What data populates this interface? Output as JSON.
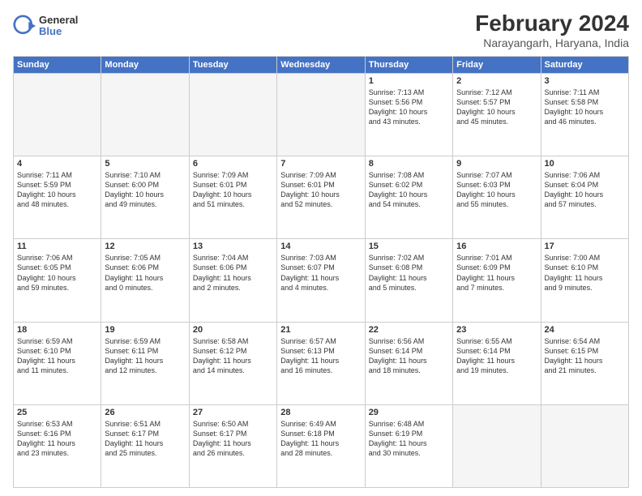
{
  "logo": {
    "general": "General",
    "blue": "Blue"
  },
  "header": {
    "title": "February 2024",
    "subtitle": "Narayangarh, Haryana, India"
  },
  "days": [
    "Sunday",
    "Monday",
    "Tuesday",
    "Wednesday",
    "Thursday",
    "Friday",
    "Saturday"
  ],
  "weeks": [
    [
      {
        "day": "",
        "content": ""
      },
      {
        "day": "",
        "content": ""
      },
      {
        "day": "",
        "content": ""
      },
      {
        "day": "",
        "content": ""
      },
      {
        "day": "1",
        "content": "Sunrise: 7:13 AM\nSunset: 5:56 PM\nDaylight: 10 hours\nand 43 minutes."
      },
      {
        "day": "2",
        "content": "Sunrise: 7:12 AM\nSunset: 5:57 PM\nDaylight: 10 hours\nand 45 minutes."
      },
      {
        "day": "3",
        "content": "Sunrise: 7:11 AM\nSunset: 5:58 PM\nDaylight: 10 hours\nand 46 minutes."
      }
    ],
    [
      {
        "day": "4",
        "content": "Sunrise: 7:11 AM\nSunset: 5:59 PM\nDaylight: 10 hours\nand 48 minutes."
      },
      {
        "day": "5",
        "content": "Sunrise: 7:10 AM\nSunset: 6:00 PM\nDaylight: 10 hours\nand 49 minutes."
      },
      {
        "day": "6",
        "content": "Sunrise: 7:09 AM\nSunset: 6:01 PM\nDaylight: 10 hours\nand 51 minutes."
      },
      {
        "day": "7",
        "content": "Sunrise: 7:09 AM\nSunset: 6:01 PM\nDaylight: 10 hours\nand 52 minutes."
      },
      {
        "day": "8",
        "content": "Sunrise: 7:08 AM\nSunset: 6:02 PM\nDaylight: 10 hours\nand 54 minutes."
      },
      {
        "day": "9",
        "content": "Sunrise: 7:07 AM\nSunset: 6:03 PM\nDaylight: 10 hours\nand 55 minutes."
      },
      {
        "day": "10",
        "content": "Sunrise: 7:06 AM\nSunset: 6:04 PM\nDaylight: 10 hours\nand 57 minutes."
      }
    ],
    [
      {
        "day": "11",
        "content": "Sunrise: 7:06 AM\nSunset: 6:05 PM\nDaylight: 10 hours\nand 59 minutes."
      },
      {
        "day": "12",
        "content": "Sunrise: 7:05 AM\nSunset: 6:06 PM\nDaylight: 11 hours\nand 0 minutes."
      },
      {
        "day": "13",
        "content": "Sunrise: 7:04 AM\nSunset: 6:06 PM\nDaylight: 11 hours\nand 2 minutes."
      },
      {
        "day": "14",
        "content": "Sunrise: 7:03 AM\nSunset: 6:07 PM\nDaylight: 11 hours\nand 4 minutes."
      },
      {
        "day": "15",
        "content": "Sunrise: 7:02 AM\nSunset: 6:08 PM\nDaylight: 11 hours\nand 5 minutes."
      },
      {
        "day": "16",
        "content": "Sunrise: 7:01 AM\nSunset: 6:09 PM\nDaylight: 11 hours\nand 7 minutes."
      },
      {
        "day": "17",
        "content": "Sunrise: 7:00 AM\nSunset: 6:10 PM\nDaylight: 11 hours\nand 9 minutes."
      }
    ],
    [
      {
        "day": "18",
        "content": "Sunrise: 6:59 AM\nSunset: 6:10 PM\nDaylight: 11 hours\nand 11 minutes."
      },
      {
        "day": "19",
        "content": "Sunrise: 6:59 AM\nSunset: 6:11 PM\nDaylight: 11 hours\nand 12 minutes."
      },
      {
        "day": "20",
        "content": "Sunrise: 6:58 AM\nSunset: 6:12 PM\nDaylight: 11 hours\nand 14 minutes."
      },
      {
        "day": "21",
        "content": "Sunrise: 6:57 AM\nSunset: 6:13 PM\nDaylight: 11 hours\nand 16 minutes."
      },
      {
        "day": "22",
        "content": "Sunrise: 6:56 AM\nSunset: 6:14 PM\nDaylight: 11 hours\nand 18 minutes."
      },
      {
        "day": "23",
        "content": "Sunrise: 6:55 AM\nSunset: 6:14 PM\nDaylight: 11 hours\nand 19 minutes."
      },
      {
        "day": "24",
        "content": "Sunrise: 6:54 AM\nSunset: 6:15 PM\nDaylight: 11 hours\nand 21 minutes."
      }
    ],
    [
      {
        "day": "25",
        "content": "Sunrise: 6:53 AM\nSunset: 6:16 PM\nDaylight: 11 hours\nand 23 minutes."
      },
      {
        "day": "26",
        "content": "Sunrise: 6:51 AM\nSunset: 6:17 PM\nDaylight: 11 hours\nand 25 minutes."
      },
      {
        "day": "27",
        "content": "Sunrise: 6:50 AM\nSunset: 6:17 PM\nDaylight: 11 hours\nand 26 minutes."
      },
      {
        "day": "28",
        "content": "Sunrise: 6:49 AM\nSunset: 6:18 PM\nDaylight: 11 hours\nand 28 minutes."
      },
      {
        "day": "29",
        "content": "Sunrise: 6:48 AM\nSunset: 6:19 PM\nDaylight: 11 hours\nand 30 minutes."
      },
      {
        "day": "",
        "content": ""
      },
      {
        "day": "",
        "content": ""
      }
    ]
  ]
}
